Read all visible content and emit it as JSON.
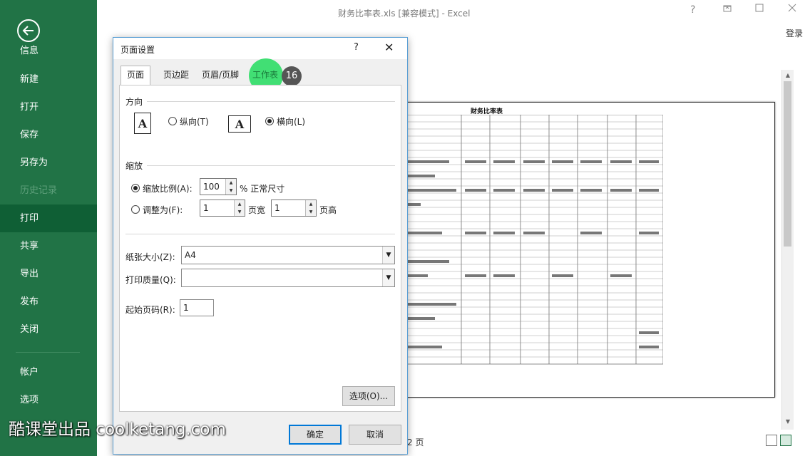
{
  "app": {
    "title": "财务比率表.xls  [兼容模式] - Excel",
    "login": "登录",
    "help": "?"
  },
  "sidebar": {
    "items": [
      {
        "label": "信息"
      },
      {
        "label": "新建"
      },
      {
        "label": "打开"
      },
      {
        "label": "保存"
      },
      {
        "label": "另存为"
      },
      {
        "label": "历史记录"
      },
      {
        "label": "打印"
      },
      {
        "label": "共享"
      },
      {
        "label": "导出"
      },
      {
        "label": "发布"
      },
      {
        "label": "关闭"
      },
      {
        "label": "帐户"
      },
      {
        "label": "选项"
      }
    ]
  },
  "dialog": {
    "title": "页面设置",
    "help": "?",
    "close": "✕",
    "tabs": [
      {
        "label": "页面"
      },
      {
        "label": "页边距"
      },
      {
        "label": "页眉/页脚"
      },
      {
        "label": "工作表"
      }
    ],
    "step_badge": "16",
    "orientation": {
      "heading": "方向",
      "portrait": "纵向(T)",
      "landscape": "横向(L)",
      "icon_letter": "A"
    },
    "scaling": {
      "heading": "缩放",
      "adjust_label": "缩放比例(A):",
      "adjust_value": "100",
      "adjust_suffix": "% 正常尺寸",
      "fit_label": "调整为(F):",
      "fit_wide": "1",
      "fit_wide_suffix": "页宽",
      "fit_tall": "1",
      "fit_tall_suffix": "页高"
    },
    "paper_size": {
      "label": "纸张大小(Z):",
      "value": "A4"
    },
    "print_quality": {
      "label": "打印质量(Q):",
      "value": ""
    },
    "first_page": {
      "label": "起始页码(R):",
      "value": "1"
    },
    "options_button": "选项(O)...",
    "ok_button": "确定",
    "cancel_button": "取消"
  },
  "preview": {
    "sheet_title": "财务比率表",
    "page_nav": "2 页"
  },
  "watermark": "酷课堂出品 coolketang.com"
}
